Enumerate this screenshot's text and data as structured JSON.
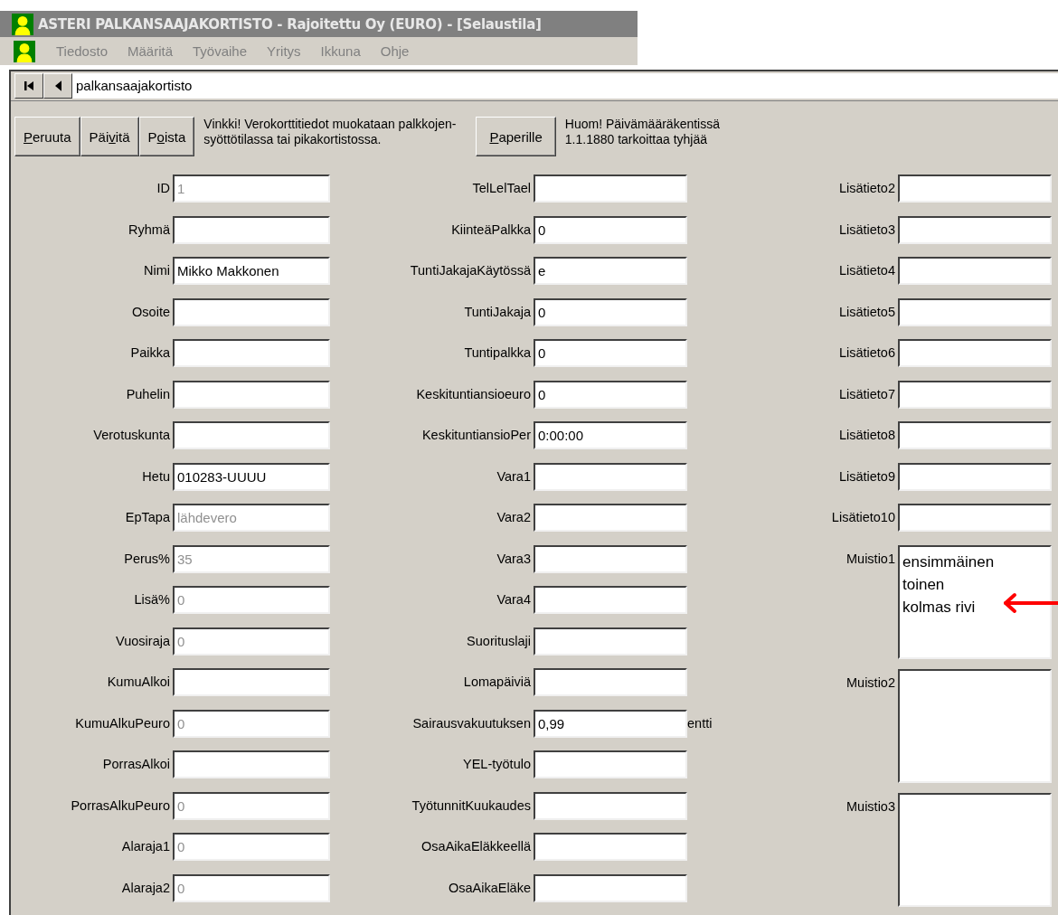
{
  "window": {
    "title": "ASTERI PALKANSAAJAKORTISTO - Rajoitettu Oy (EURO) - [Selaustila]"
  },
  "menu": [
    {
      "label": "Tiedosto",
      "disabled": true
    },
    {
      "label": "Määritä",
      "disabled": true
    },
    {
      "label": "Työvaihe",
      "disabled": true
    },
    {
      "label": "Yritys",
      "disabled": true
    },
    {
      "label": "Ikkuna",
      "disabled": true
    },
    {
      "label": "Ohje",
      "disabled": true
    }
  ],
  "navigator": {
    "path": "palkansaajakortisto"
  },
  "toolbar": {
    "buttons": [
      {
        "key": "P",
        "post": "eruuta"
      },
      {
        "pre": "Päi",
        "key": "v",
        "post": "itä"
      },
      {
        "pre": "P",
        "key": "o",
        "post": "ista"
      }
    ],
    "tip": "Vinkki! Verokorttitiedot muokataan palkkojen-\nsyöttötilassa tai pikakortistossa.",
    "print_button": {
      "key": "P",
      "post": "aperille"
    },
    "note": "Huom! Päivämääräkentissä\n1.1.1880 tarkoittaa tyhjää"
  },
  "columns": [
    [
      {
        "label": "ID",
        "value": "1",
        "disabled": true
      },
      {
        "label": "Ryhmä"
      },
      {
        "label": "Nimi",
        "value": "Mikko Makkonen",
        "disabled": false
      },
      {
        "label": "Osoite"
      },
      {
        "label": "Paikka"
      },
      {
        "label": "Puhelin"
      },
      {
        "label": "Verotuskunta"
      },
      {
        "label": "Hetu",
        "value": "010283-UUUU",
        "disabled": false
      },
      {
        "label": "EpTapa",
        "value": "lähdevero",
        "disabled": true
      },
      {
        "label": "Perus%",
        "value": "35",
        "disabled": true
      },
      {
        "label": "Lisä%",
        "value": "0",
        "disabled": true
      },
      {
        "label": "Vuosiraja",
        "value": "0",
        "disabled": true
      },
      {
        "label": "KumuAlkoi"
      },
      {
        "label": "KumuAlkuPeuro",
        "value": "0",
        "disabled": true
      },
      {
        "label": "PorrasAlkoi"
      },
      {
        "label": "PorrasAlkuPeuro",
        "value": "0",
        "disabled": true
      },
      {
        "label": "Alaraja1",
        "value": "0",
        "disabled": true
      },
      {
        "label": "Alaraja2",
        "value": "0",
        "disabled": true
      }
    ],
    [
      {
        "label": "TelLelTael"
      },
      {
        "label": "KiinteäPalkka",
        "value": "0",
        "disabled": false
      },
      {
        "label": "TuntiJakajaKäytössä",
        "value": "e",
        "disabled": false
      },
      {
        "label": "TuntiJakaja",
        "value": "0",
        "disabled": false
      },
      {
        "label": "Tuntipalkka",
        "value": "0",
        "disabled": false
      },
      {
        "label": "Keskituntiansioeuro",
        "value": "0",
        "disabled": false
      },
      {
        "label": "KeskituntiansioPer",
        "value": "0:00:00",
        "disabled": false
      },
      {
        "label": "Vara1"
      },
      {
        "label": "Vara2"
      },
      {
        "label": "Vara3"
      },
      {
        "label": "Vara4"
      },
      {
        "label": "Suorituslaji"
      },
      {
        "label": "Lomapäiviä"
      },
      {
        "label": "Sairausvakuutuksen",
        "value": "0,99",
        "suffix": "entti",
        "disabled": false
      },
      {
        "label": "YEL-työtulo"
      },
      {
        "label": "TyötunnitKuukaudes"
      },
      {
        "label": "OsaAikaEläkkeellä"
      },
      {
        "label": "OsaAikaEläke"
      }
    ],
    [
      {
        "label": "Lisätieto2"
      },
      {
        "label": "Lisätieto3"
      },
      {
        "label": "Lisätieto4"
      },
      {
        "label": "Lisätieto5"
      },
      {
        "label": "Lisätieto6"
      },
      {
        "label": "Lisätieto7"
      },
      {
        "label": "Lisätieto8"
      },
      {
        "label": "Lisätieto9"
      },
      {
        "label": "Lisätieto10"
      },
      {
        "label": "Muistio1",
        "kind": "memo",
        "lines": [
          "ensimmäinen",
          "toinen",
          "kolmas rivi"
        ],
        "marked": true
      },
      {
        "label": "Muistio2",
        "kind": "memo",
        "marked": false
      },
      {
        "label": "Muistio3",
        "kind": "memo",
        "marked": false
      }
    ]
  ]
}
